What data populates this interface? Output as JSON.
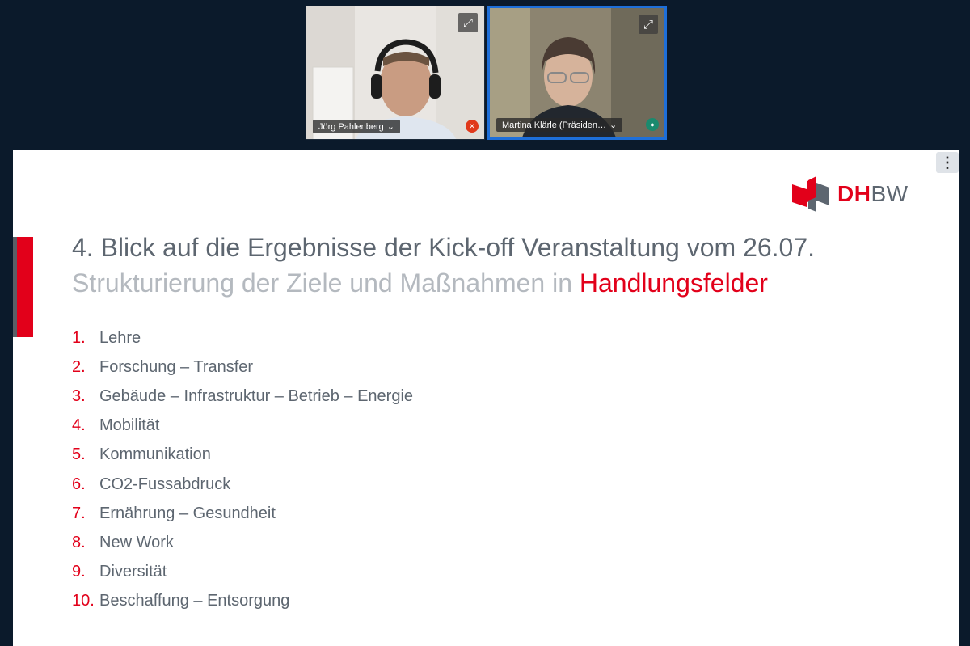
{
  "participants": [
    {
      "name": "Jörg Pahlenberg",
      "caret": "⌄",
      "mic": "muted"
    },
    {
      "name": "Martina Klärle (Präsiden…",
      "caret": "⌄",
      "mic": "active"
    }
  ],
  "slide": {
    "logo_dh": "DH",
    "logo_bw": "BW",
    "title": "4. Blick auf die Ergebnisse der Kick-off Veranstaltung vom 26.07.",
    "subtitle_prefix": "Strukturierung der Ziele und Maßnahmen in ",
    "subtitle_highlight": "Handlungsfelder",
    "items": [
      {
        "num": "1.",
        "label": "Lehre"
      },
      {
        "num": "2.",
        "label": "Forschung – Transfer"
      },
      {
        "num": "3.",
        "label": "Gebäude – Infrastruktur – Betrieb – Energie"
      },
      {
        "num": "4.",
        "label": "Mobilität"
      },
      {
        "num": "5.",
        "label": "Kommunikation"
      },
      {
        "num": "6.",
        "label": "CO2-Fussabdruck"
      },
      {
        "num": "7.",
        "label": "Ernährung – Gesundheit"
      },
      {
        "num": "8.",
        "label": "New Work"
      },
      {
        "num": "9.",
        "label": "Diversität"
      },
      {
        "num": "10.",
        "label": "Beschaffung – Entsorgung"
      }
    ]
  },
  "colors": {
    "accent": "#e2001a",
    "background": "#0b1a2b",
    "active_border": "#1e6fd9"
  }
}
